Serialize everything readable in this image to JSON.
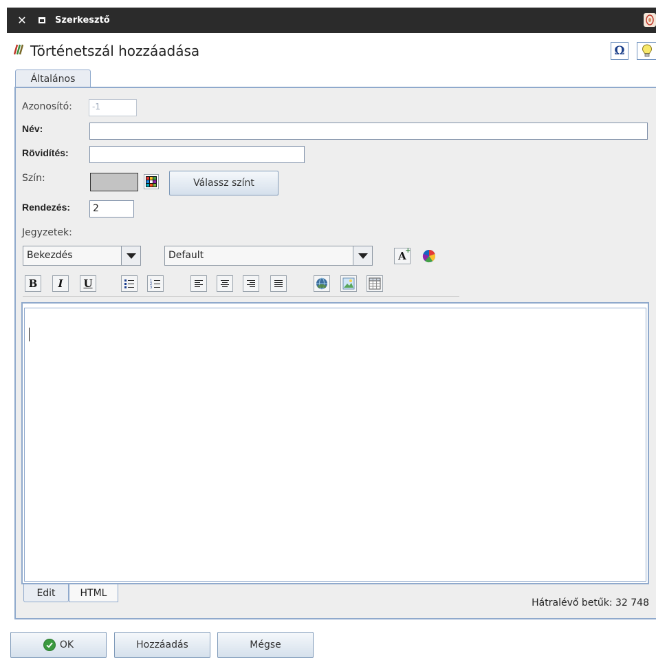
{
  "window": {
    "title": "Szerkesztő"
  },
  "dialog": {
    "heading": "Történetszál hozzáadása"
  },
  "tabs": {
    "general": "Általános"
  },
  "form": {
    "id_label": "Azonosító:",
    "id_value": "-1",
    "name_label": "Név:",
    "name_value": "",
    "abbr_label": "Rövidítés:",
    "abbr_value": "",
    "color_label": "Szín:",
    "choose_color": "Válassz színt",
    "color_value": "#c3c3c3",
    "order_label": "Rendezés:",
    "order_value": "2",
    "notes_label": "Jegyzetek:"
  },
  "editor": {
    "paragraph_style": "Bekezdés",
    "font": "Default",
    "toolbar_icons": [
      "bold-icon",
      "italic-icon",
      "underline-icon",
      "bulleted-list-icon",
      "numbered-list-icon",
      "align-left-icon",
      "align-center-icon",
      "align-right-icon",
      "justify-icon",
      "link-icon",
      "image-icon",
      "table-icon"
    ],
    "format": {
      "bold": "B",
      "italic": "I",
      "underline": "U"
    },
    "subtabs": {
      "edit": "Edit",
      "html": "HTML"
    },
    "remaining": "Hátralévő betűk: 32 748"
  },
  "buttons": {
    "ok": "OK",
    "add": "Hozzáadás",
    "cancel": "Mégse"
  },
  "colors": {
    "titlebar": "#2b2b2b",
    "accent": "#8fa9cc",
    "ok_check": "#3b9a3f"
  }
}
